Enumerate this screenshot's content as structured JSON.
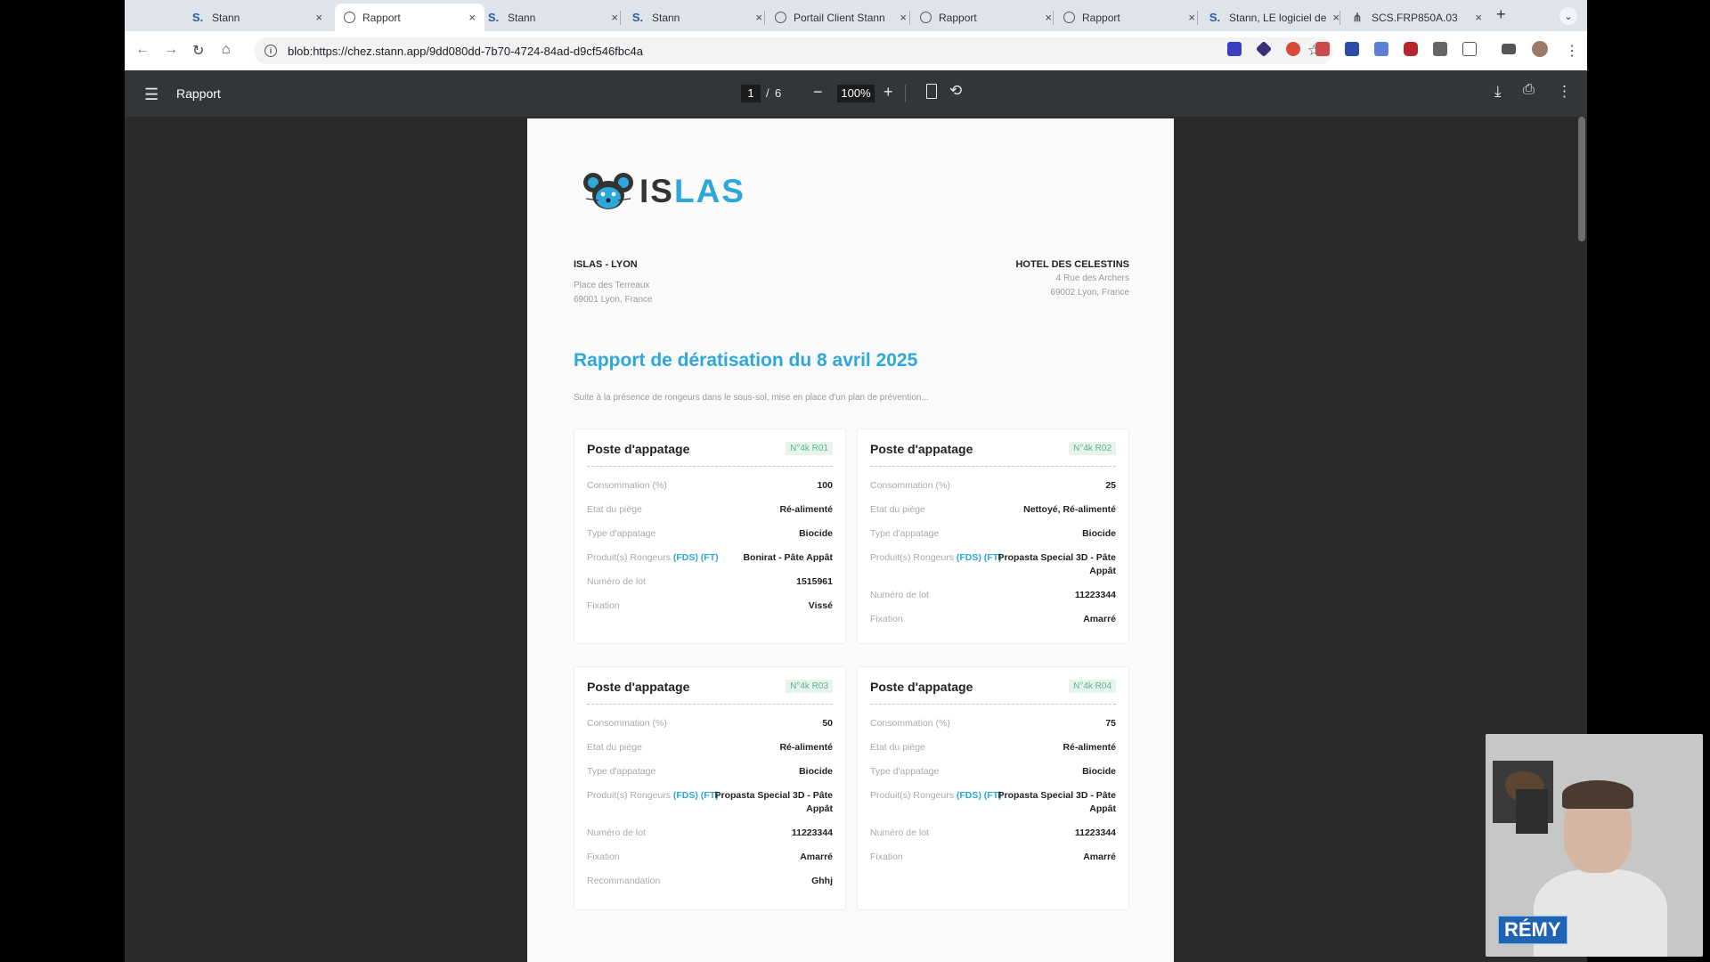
{
  "tabs": [
    {
      "title": "Stann",
      "icon": "stann-icon",
      "active": false
    },
    {
      "title": "Rapport",
      "icon": "globe-icon",
      "active": true
    },
    {
      "title": "Stann",
      "icon": "stann-icon",
      "active": false
    },
    {
      "title": "Stann",
      "icon": "stann-icon",
      "active": false
    },
    {
      "title": "Portail Client Stann",
      "icon": "globe-icon",
      "active": false
    },
    {
      "title": "Rapport",
      "icon": "globe-icon",
      "active": false
    },
    {
      "title": "Rapport",
      "icon": "globe-icon",
      "active": false
    },
    {
      "title": "Stann, LE logiciel de",
      "icon": "stann-icon",
      "active": false
    },
    {
      "title": "SCS.FRP850A.03",
      "icon": "sheet-icon",
      "active": false
    }
  ],
  "address": {
    "url": "blob:https://chez.stann.app/9dd080dd-7b70-4724-84ad-d9cf546fbc4a"
  },
  "pdf": {
    "title": "Rapport",
    "page_current": "1",
    "page_sep": "/",
    "page_total": "6",
    "zoom": "100%"
  },
  "report": {
    "logo_a": "IS",
    "logo_b": "LAS",
    "from": {
      "name": "ISLAS - LYON",
      "line1": "Place des Terreaux",
      "line2": "69001 Lyon, France"
    },
    "to": {
      "name": "HOTEL DES CELESTINS",
      "line1": "4 Rue des Archers",
      "line2": "69002 Lyon, France"
    },
    "title": "Rapport de dératisation du 8 avril 2025",
    "subtitle": "Suite à la présence de rongeurs dans le sous-sol, mise en place d'un plan de prévention...",
    "cards": [
      {
        "title": "Poste d'appatage",
        "badge": "N°4k R01",
        "rows": [
          {
            "label": "Consommation (%)",
            "value": "100"
          },
          {
            "label": "Etat du piège",
            "value": "Ré-alimenté"
          },
          {
            "label": "Type d'appatage",
            "value": "Biocide"
          },
          {
            "label": "Produit(s) Rongeurs",
            "links": "(FDS) (FT)",
            "value": "Bonirat - Pâte Appât"
          },
          {
            "label": "Numéro de lot",
            "value": "1515961"
          },
          {
            "label": "Fixation",
            "value": "Vissé"
          }
        ]
      },
      {
        "title": "Poste d'appatage",
        "badge": "N°4k R02",
        "rows": [
          {
            "label": "Consommation (%)",
            "value": "25"
          },
          {
            "label": "Etat du piège",
            "value": "Nettoyé, Ré-alimenté"
          },
          {
            "label": "Type d'appatage",
            "value": "Biocide"
          },
          {
            "label": "Produit(s) Rongeurs",
            "links": "(FDS) (FT)",
            "value": "Propasta Special 3D - Pâte Appât"
          },
          {
            "label": "Numéro de lot",
            "value": "11223344"
          },
          {
            "label": "Fixation",
            "value": "Amarré"
          }
        ]
      },
      {
        "title": "Poste d'appatage",
        "badge": "N°4k R03",
        "rows": [
          {
            "label": "Consommation (%)",
            "value": "50"
          },
          {
            "label": "Etat du piège",
            "value": "Ré-alimenté"
          },
          {
            "label": "Type d'appatage",
            "value": "Biocide"
          },
          {
            "label": "Produit(s) Rongeurs",
            "links": "(FDS) (FT)",
            "value": "Propasta Special 3D - Pâte Appât"
          },
          {
            "label": "Numéro de lot",
            "value": "11223344"
          },
          {
            "label": "Fixation",
            "value": "Amarré"
          },
          {
            "label": "Recommandation",
            "value": "Ghhj"
          }
        ]
      },
      {
        "title": "Poste d'appatage",
        "badge": "N°4k R04",
        "rows": [
          {
            "label": "Consommation (%)",
            "value": "75"
          },
          {
            "label": "Etat du piège",
            "value": "Ré-alimenté"
          },
          {
            "label": "Type d'appatage",
            "value": "Biocide"
          },
          {
            "label": "Produit(s) Rongeurs",
            "links": "(FDS) (FT)",
            "value": "Propasta Special 3D - Pâte Appât"
          },
          {
            "label": "Numéro de lot",
            "value": "11223344"
          },
          {
            "label": "Fixation",
            "value": "Amarré"
          }
        ]
      }
    ]
  },
  "webcam": {
    "name": "RÉMY"
  },
  "colors": {
    "accent": "#2ea7db",
    "badge": "#5cb489",
    "viewer_bg": "#2b2b2b",
    "toolbar_bg": "#323639"
  }
}
